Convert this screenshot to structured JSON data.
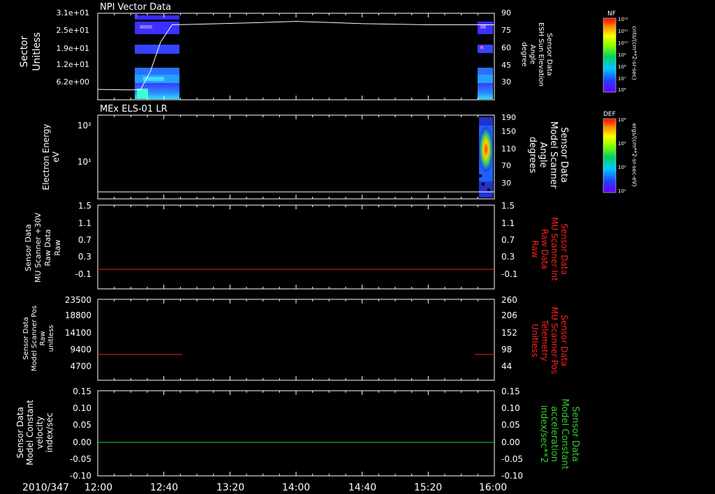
{
  "figure": {
    "date_label": "2010/347",
    "time_ticks": [
      "12:00",
      "12:40",
      "13:20",
      "14:00",
      "14:40",
      "15:20",
      "16:00"
    ],
    "colors": {
      "background": "#000000",
      "axis": "#ffffff",
      "red_trace": "#ff2020",
      "green_trace": "#33cc33"
    }
  },
  "colorbars": [
    {
      "label": "NF",
      "units": "cnts/(cm**2-sr-sec)",
      "ticks": [
        "10¹²",
        "10¹¹",
        "10¹⁰",
        "10⁹",
        "10⁸",
        "10⁷",
        "10⁶"
      ]
    },
    {
      "label": "DEF",
      "units": "ergs/(cm**2-sr-sec-eV)",
      "ticks": [
        "10⁴",
        "10³",
        "10²",
        "10¹"
      ]
    }
  ],
  "chart_data": [
    {
      "type": "heatmap",
      "title": "NPI Vector Data",
      "ylabel_lines": [
        "Sector",
        "Unitless"
      ],
      "yticks_left": [
        "3.1e+01",
        "2.5e+01",
        "1.9e+01",
        "1.2e+01",
        "6.2e+00"
      ],
      "right_label_lines": [
        "Sensor Data",
        "ESH Sun Elevation",
        "Angle",
        "degree"
      ],
      "yticks_right": [
        "90",
        "75",
        "60",
        "45",
        "30"
      ],
      "right_ylim": [
        15,
        90
      ],
      "overlay_line": {
        "color": "#ffffff",
        "x": [
          "12:00",
          "12:20",
          "12:26",
          "12:32",
          "12:38",
          "12:45",
          "13:00",
          "13:40",
          "14:00",
          "14:40",
          "15:20",
          "16:00"
        ],
        "y": [
          24,
          23.5,
          24,
          40,
          65,
          80,
          80.5,
          82,
          83,
          81,
          80,
          80
        ]
      },
      "data_blocks": [
        {
          "x_start": "12:27",
          "x_end": "12:47",
          "sectors": "1-31"
        },
        {
          "x_start": "15:50",
          "x_end": "16:00",
          "sectors": "1-31"
        }
      ]
    },
    {
      "type": "heatmap",
      "title": "MEx ELS-01 LR",
      "ylabel_lines": [
        "Electron Energy",
        "eV"
      ],
      "yticks_left": [
        "10²",
        "10¹"
      ],
      "right_label_lines": [
        "Sensor Data",
        "Model Scanner",
        "Angle",
        "degrees"
      ],
      "yticks_right": [
        "190",
        "150",
        "110",
        "70",
        "30"
      ],
      "right_ylim": [
        0,
        190
      ],
      "overlay_line": {
        "color": "#ffffff",
        "x": [
          "12:00",
          "16:00"
        ],
        "y": [
          7,
          7
        ]
      },
      "data_blocks": [
        {
          "x_start": "15:50",
          "x_end": "16:00"
        }
      ]
    },
    {
      "type": "line",
      "ylabel_lines": [
        "Sensor Data",
        "MU Scanner +30V",
        "Raw Data",
        "Raw"
      ],
      "yticks_left": [
        "1.5",
        "1.1",
        "0.7",
        "0.3",
        "-0.1"
      ],
      "right_label_lines": [
        "Sensor Data",
        "MU Scanner Int",
        "Raw Data",
        "Raw"
      ],
      "yticks_right": [
        "1.5",
        "1.1",
        "0.7",
        "0.3",
        "-0.1"
      ],
      "ylim": [
        -0.3,
        1.5
      ],
      "series": [
        {
          "color": "#ff2020",
          "x": [
            "12:00",
            "16:00"
          ],
          "y": [
            -0.03,
            -0.03
          ]
        }
      ]
    },
    {
      "type": "line",
      "ylabel_lines": [
        "Sensor Data",
        "Model Scanner Pos",
        "Raw",
        "unitless"
      ],
      "yticks_left": [
        "23500",
        "18800",
        "14100",
        "9400",
        "4700"
      ],
      "right_label_lines": [
        "Sensor Data",
        "MU Scanner Pos",
        "Telemetry",
        "Unitless"
      ],
      "yticks_right": [
        "260",
        "206",
        "152",
        "98",
        "44"
      ],
      "ylim": [
        0,
        23500
      ],
      "series": [
        {
          "color": "#ff2020",
          "x": [
            "12:00",
            "12:47"
          ],
          "y": [
            8400,
            8400
          ]
        },
        {
          "color": "#ff2020",
          "x": [
            "15:50",
            "16:00"
          ],
          "y": [
            8400,
            8400
          ]
        }
      ]
    },
    {
      "type": "line",
      "ylabel_lines": [
        "Sensor Data",
        "Model Constant",
        "velocity",
        "index/sec"
      ],
      "yticks_left": [
        "0.15",
        "0.10",
        "0.05",
        "0.00",
        "-0.05",
        "-0.10"
      ],
      "right_label_lines": [
        "Sensor Data",
        "Model Constant",
        "acceleration",
        "index/sec**2"
      ],
      "yticks_right": [
        "0.15",
        "0.10",
        "0.05",
        "0.00",
        "-0.05",
        "-0.10"
      ],
      "ylim": [
        -0.1,
        0.15
      ],
      "series": [
        {
          "color": "#33cc33",
          "x": [
            "12:00",
            "16:00"
          ],
          "y": [
            0,
            0
          ]
        }
      ]
    }
  ]
}
